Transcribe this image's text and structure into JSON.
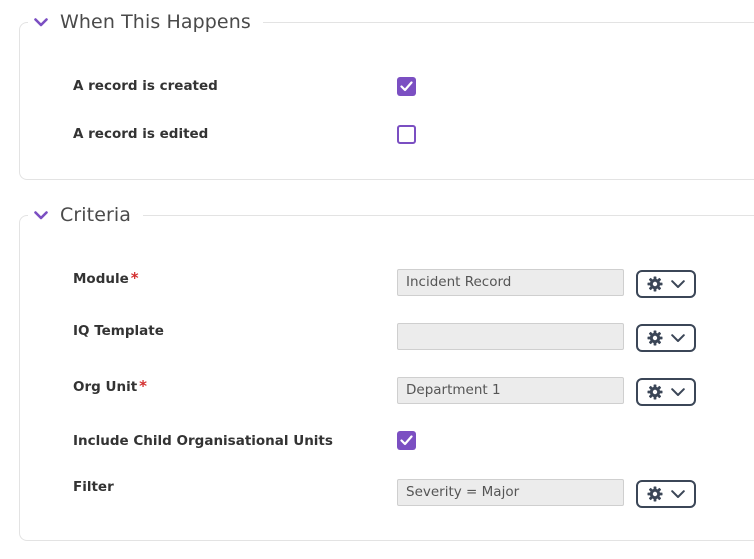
{
  "colors": {
    "accent": "#7b4fc2",
    "required": "#d32f2f",
    "button_border": "#3b4657"
  },
  "icons": {
    "section_toggle": "chevron-down-icon",
    "settings": "gear-icon",
    "dropdown": "chevron-down-icon",
    "check": "check-icon"
  },
  "when_section": {
    "title": "When This Happens",
    "rows": [
      {
        "label": "A record is created",
        "checked": true
      },
      {
        "label": "A record is edited",
        "checked": false
      }
    ]
  },
  "criteria_section": {
    "title": "Criteria",
    "required_marker": "*",
    "module": {
      "label": "Module",
      "required": true,
      "value": "Incident Record"
    },
    "iq_template": {
      "label": "IQ Template",
      "required": false,
      "value": ""
    },
    "org_unit": {
      "label": "Org Unit",
      "required": true,
      "value": "Department 1"
    },
    "include_child": {
      "label": "Include Child Organisational Units",
      "checked": true
    },
    "filter": {
      "label": "Filter",
      "value": "Severity = Major"
    }
  }
}
